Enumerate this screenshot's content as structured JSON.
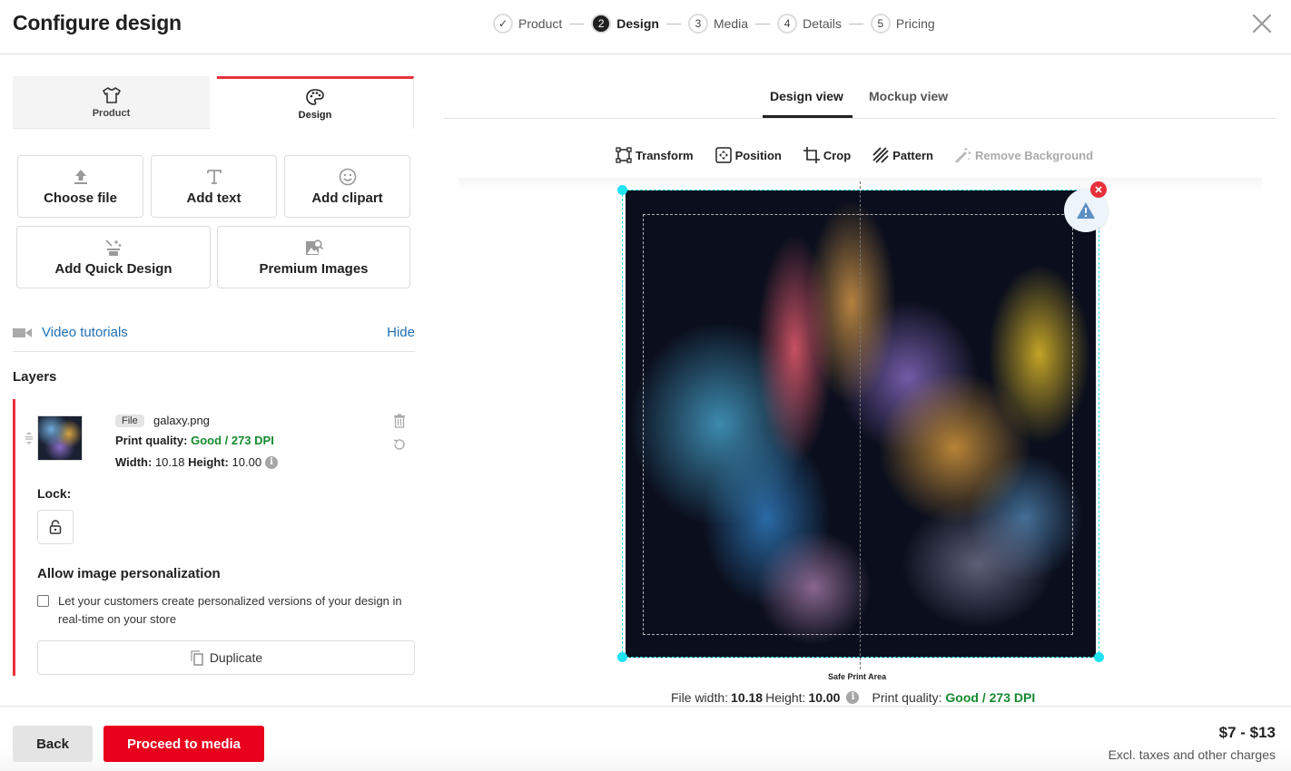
{
  "header": {
    "title": "Configure design",
    "steps": [
      {
        "marker": "✓",
        "label": "Product",
        "state": "done"
      },
      {
        "marker": "2",
        "label": "Design",
        "state": "active"
      },
      {
        "marker": "3",
        "label": "Media",
        "state": "todo"
      },
      {
        "marker": "4",
        "label": "Details",
        "state": "todo"
      },
      {
        "marker": "5",
        "label": "Pricing",
        "state": "todo"
      }
    ],
    "close_icon": "close-icon"
  },
  "panel_tabs": [
    {
      "label": "Product",
      "icon": "tshirt-icon",
      "active": false
    },
    {
      "label": "Design",
      "icon": "palette-icon",
      "active": true
    }
  ],
  "tools": [
    {
      "label": "Choose file",
      "icon": "upload-icon"
    },
    {
      "label": "Add text",
      "icon": "text-icon"
    },
    {
      "label": "Add clipart",
      "icon": "smiley-icon"
    },
    {
      "label": "Add Quick Design",
      "icon": "magic-wand-icon"
    },
    {
      "label": "Premium Images",
      "icon": "image-search-icon"
    }
  ],
  "video": {
    "label": "Video tutorials",
    "hide_label": "Hide",
    "icon": "video-camera-icon"
  },
  "layers": {
    "title": "Layers",
    "items": [
      {
        "type_tag": "File",
        "file_name": "galaxy.png",
        "print_quality_label": "Print quality:",
        "print_quality_value": "Good / 273 DPI",
        "width_label": "Width:",
        "width_value": "10.18",
        "height_label": "Height:",
        "height_value": "10.00",
        "lock_label": "Lock:",
        "locked": false,
        "personalization_title": "Allow image personalization",
        "personalization_text": "Let your customers create personalized versions of your design in real-time on your store",
        "personalization_checked": false,
        "duplicate_label": "Duplicate"
      }
    ]
  },
  "view_tabs": [
    {
      "label": "Design view",
      "active": true
    },
    {
      "label": "Mockup view",
      "active": false
    }
  ],
  "toolbar": [
    {
      "label": "Transform",
      "icon": "transform-icon",
      "disabled": false
    },
    {
      "label": "Position",
      "icon": "position-icon",
      "disabled": false
    },
    {
      "label": "Crop",
      "icon": "crop-icon",
      "disabled": false
    },
    {
      "label": "Pattern",
      "icon": "pattern-icon",
      "disabled": false
    },
    {
      "label": "Remove Background",
      "icon": "magic-wand-icon",
      "disabled": true
    }
  ],
  "canvas": {
    "safe_area_label": "Safe Print Area",
    "file_width_label": "File width:",
    "file_width_value": "10.18",
    "height_label": "Height:",
    "height_value": "10.00",
    "print_quality_label": "Print quality:",
    "print_quality_value": "Good / 273 DPI"
  },
  "footer": {
    "back_label": "Back",
    "proceed_label": "Proceed to media",
    "price": "$7 - $13",
    "price_note": "Excl. taxes and other charges"
  },
  "colors": {
    "accent_red": "#e8001c",
    "tab_red": "#e8313b",
    "good_green": "#168a2e",
    "link_blue": "#1f6fb5",
    "selection_cyan": "#1fe3f0"
  }
}
